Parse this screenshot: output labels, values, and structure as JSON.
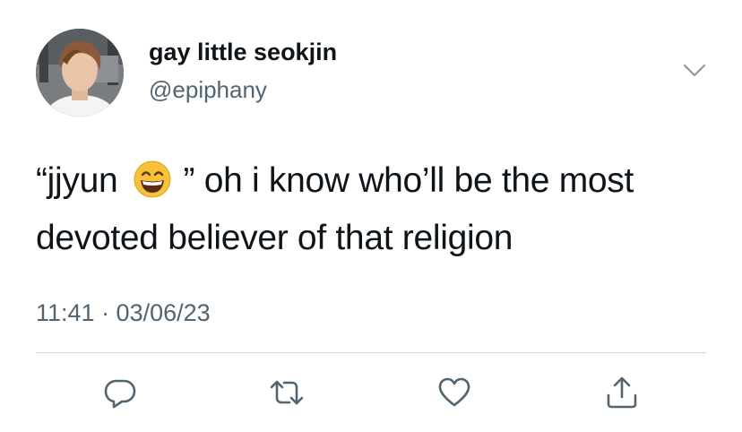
{
  "tweet": {
    "author": {
      "display_name": "gay little seokjin",
      "handle": "@epiphany"
    },
    "text_before_emoji": "“jjyun ",
    "emoji": "grinning-face-with-smiling-eyes",
    "text_after_emoji": " ” oh i know who’ll be the most devoted believer of that religion",
    "timestamp": "11:41 · 03/06/23"
  },
  "actions": [
    {
      "name": "reply",
      "icon": "reply-icon"
    },
    {
      "name": "retweet",
      "icon": "retweet-icon"
    },
    {
      "name": "like",
      "icon": "heart-icon"
    },
    {
      "name": "share",
      "icon": "share-icon"
    }
  ],
  "colors": {
    "text_primary": "#0f1419",
    "text_secondary": "#536471",
    "divider": "#cfd9de",
    "emoji_yellow": "#f7c23a"
  }
}
